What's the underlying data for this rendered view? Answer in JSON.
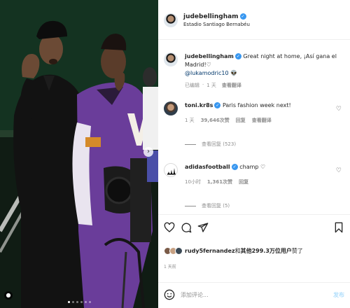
{
  "post": {
    "username": "judebellingham",
    "location": "Estadio Santiago Bernabéu",
    "caption_username": "judebellingham",
    "caption_text": "Great night at home, ¡Así gana el Madrid!♡",
    "caption_mention": "@lukamodric10",
    "caption_emoji": "👽",
    "caption_meta_edited": "已编辑",
    "caption_meta_dot": "·",
    "caption_meta_time": "1 天",
    "caption_meta_translate": "查看翻译",
    "photo_dots": 6,
    "photo_active_dot": 0
  },
  "comments": [
    {
      "username": "toni.kr8s",
      "text": "Paris fashion week next!",
      "time": "1 天",
      "likes": "39,646次赞",
      "reply": "回复",
      "translate": "查看翻译",
      "view_replies": "查看回复 (523)"
    },
    {
      "username": "adidasfootball",
      "text": "champ ♡",
      "time": "10小时",
      "likes": "1,361次赞",
      "reply": "回复",
      "view_replies": "查看回复 (5)"
    }
  ],
  "likes_bar": {
    "liker": "rudy5fernandez",
    "connector": "和",
    "others": "其他299.3万位用户",
    "suffix": "赞了"
  },
  "posted_ago": "1 天前",
  "add_comment": {
    "placeholder": "添加评论...",
    "post_label": "发布"
  },
  "icons": {
    "heart": "heart-icon",
    "comment": "comment-icon",
    "share": "share-icon",
    "save": "bookmark-icon",
    "emoji": "emoji-icon",
    "verified": "verified-badge-icon"
  },
  "colors": {
    "verified_blue": "#3897f0",
    "mention_blue": "#00376b",
    "muted_gray": "#8e8e8e",
    "post_button_disabled": "#b2dffc"
  }
}
